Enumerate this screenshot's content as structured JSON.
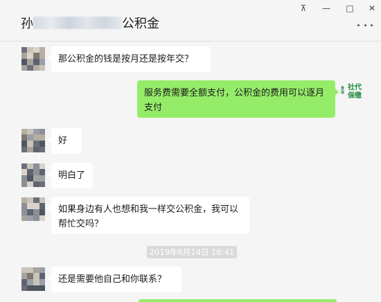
{
  "window": {
    "pin_glyph": "⊼",
    "minimize_glyph": "—",
    "maximize_glyph": "□",
    "close_glyph": "✕"
  },
  "header": {
    "title_prefix": "孙",
    "title_suffix": "公积金",
    "more_icon": "more-dots-icon"
  },
  "messages": [
    {
      "side": "in",
      "text": "那公积金的钱是按月还是按年交？"
    },
    {
      "side": "out",
      "text": "服务费需要全额支付，公积金的费用可以逐月支付"
    },
    {
      "side": "in",
      "text": "好"
    },
    {
      "side": "in",
      "text": "明白了"
    },
    {
      "side": "in",
      "text": "如果身边有人也想和我一样交公积金，我可以帮忙交吗？"
    },
    {
      "side": "in",
      "text": "还是需要他自己和你联系？"
    }
  ],
  "timestamp": "2019年6月14日 16:41",
  "self_logo": {
    "small_text": "贵深",
    "main_text": "社代保缴"
  },
  "colors": {
    "outgoing": "#95ec69",
    "incoming": "#ffffff",
    "background": "#f5f5f5"
  }
}
